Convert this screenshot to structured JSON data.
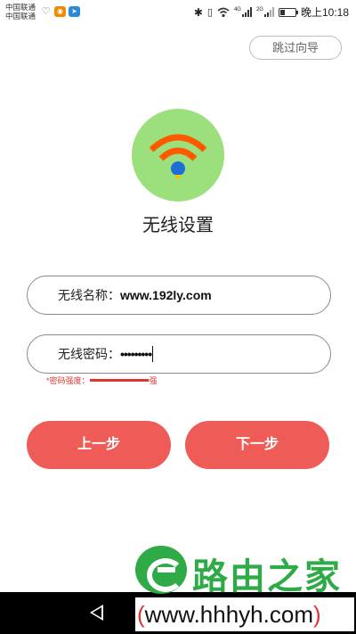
{
  "status_bar": {
    "carrier_1": "中国联通",
    "carrier_2": "中国联通",
    "network_1": "4G",
    "network_2": "2G",
    "time": "晚上10:18"
  },
  "skip_label": "跳过向导",
  "title": "无线设置",
  "ssid": {
    "label": "无线名称：",
    "value": "www.192ly.com"
  },
  "password": {
    "label": "无线密码：",
    "value": "•••••••••"
  },
  "strength": {
    "label": "*密码强度：",
    "level_text": "强",
    "level_fraction": 1.0
  },
  "buttons": {
    "prev": "上一步",
    "next": "下一步"
  },
  "watermark": {
    "brand": "路由之家",
    "url_open": "(",
    "url": "www.hhhyh.com",
    "url_close": ")"
  },
  "colors": {
    "accent": "#ef5b57",
    "wifi_circle": "#9be07c",
    "wifi_arcs": "#ff5a00",
    "wifi_dot": "#1e6ed8",
    "warning": "#e0342f",
    "watermark_green": "#2eaa47"
  },
  "icons": {
    "status": [
      "heart-icon",
      "weibo-icon",
      "airplane-app-icon",
      "bluetooth-icon",
      "vibrate-icon",
      "wifi-icon",
      "signal-icon",
      "battery-icon"
    ],
    "logo": "wifi-icon",
    "nav": [
      "back-icon",
      "home-icon"
    ]
  }
}
